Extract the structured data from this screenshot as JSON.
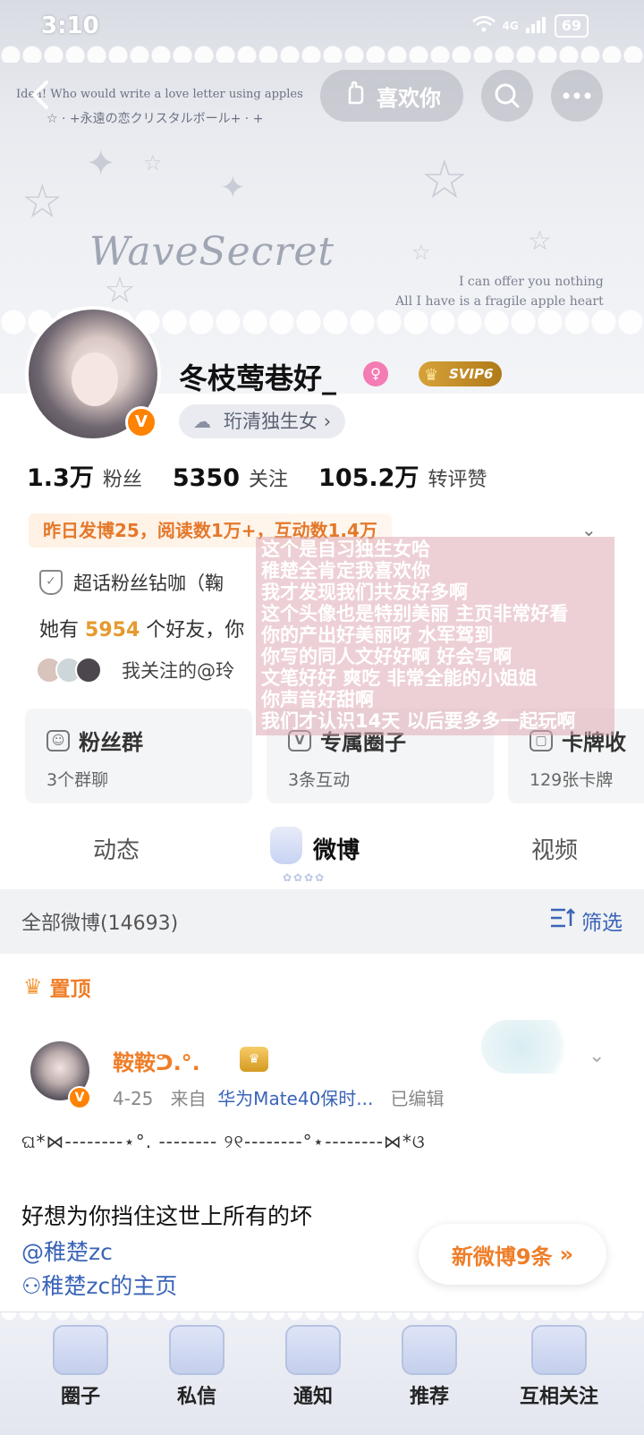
{
  "status_bar": {
    "time": "3:10",
    "network": "4G",
    "battery": "69"
  },
  "banner": {
    "line1": "Idea! Who would write a love letter using apples",
    "line2": "☆ · +永遠の恋クリスタルボール+ · +",
    "logo": "WaveSecret",
    "quote_line1": "I can offer you nothing",
    "quote_line2": "All I have is a fragile apple heart"
  },
  "top_bar": {
    "like_label": "喜欢你"
  },
  "profile": {
    "nickname": "冬枝莺巷好_",
    "vip": "SVIP6",
    "fan_tag": "珩清独生女",
    "stats": [
      {
        "num": "1.3万",
        "label": "粉丝"
      },
      {
        "num": "5350",
        "label": "关注"
      },
      {
        "num": "105.2万",
        "label": "转评赞"
      }
    ],
    "post_summary": "昨日发博25，阅读数1万+，互动数1.4万",
    "supertopic": "超话粉丝钻咖（鞠",
    "friends_prefix": "她有",
    "friends_count": "5954",
    "friends_suffix": "个好友，你",
    "mutual_text": "我关注的@玲"
  },
  "overlay_lines": [
    "这个是自习独生女哈",
    "稚楚全肯定我喜欢你",
    "我才发现我们共友好多啊",
    "这个头像也是特别美丽 主页非常好看",
    "你的产出好美丽呀 水军驾到",
    "你写的同人文好好啊 好会写啊",
    "文笔好好 爽吃 非常全能的小姐姐",
    "你声音好甜啊",
    "我们才认识14天 以后要多多一起玩啊"
  ],
  "cards": [
    {
      "title": "粉丝群",
      "sub": "3个群聊"
    },
    {
      "title": "专属圈子",
      "sub": "3条互动"
    },
    {
      "title": "卡牌收",
      "sub": "129张卡牌"
    }
  ],
  "tabs": {
    "dynamic": "动态",
    "weibo": "微博",
    "video": "视频"
  },
  "filter_bar": {
    "title": "全部微博(14693)",
    "filter_label": "筛选"
  },
  "post": {
    "pin_label": "置顶",
    "author": "鞍鞍ᕤ.°.",
    "date": "4-25",
    "from_label": "来自",
    "source": "华为Mate40保时...",
    "edited": "已编辑",
    "deco_line": "ଘ*⋈--------⋆°. -------- ୨୧--------°⋆--------⋈*ଓ",
    "text": "好想为你挡住这世上所有的坏",
    "mention": "@稚楚zc",
    "homepage": "稚楚zc的主页"
  },
  "new_posts_label": "新微博9条",
  "bottom_nav": [
    "圈子",
    "私信",
    "通知",
    "推荐",
    "互相关注"
  ]
}
